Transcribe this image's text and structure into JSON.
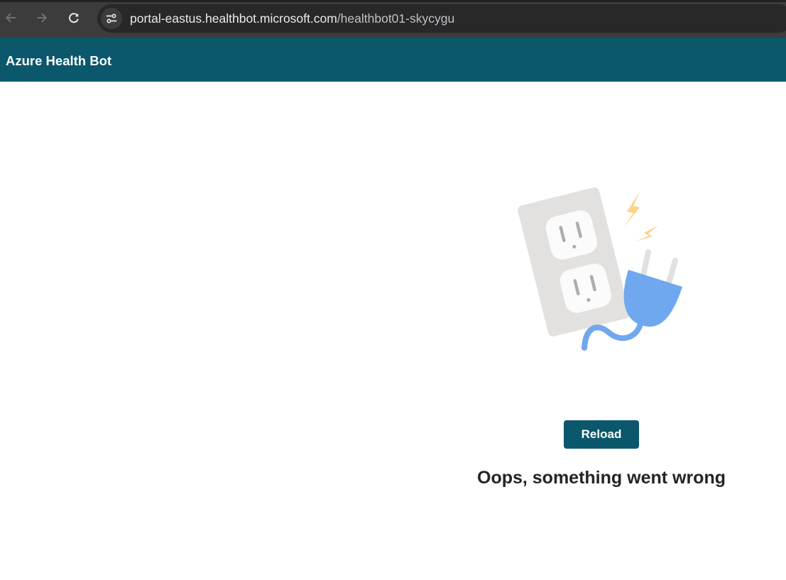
{
  "browser": {
    "url_host": "portal-eastus.healthbot.microsoft.com",
    "url_path": "/healthbot01-skycygu",
    "icons": {
      "back": "arrow-left-icon",
      "forward": "arrow-right-icon",
      "reload": "reload-icon",
      "site_info": "tune-icon"
    }
  },
  "header": {
    "title": "Azure Health Bot"
  },
  "error": {
    "illustration": "unplugged-outlet-illustration",
    "reload_label": "Reload",
    "message": "Oops, something went wrong"
  },
  "colors": {
    "brand": "#0b576b",
    "plug": "#6fa8ef",
    "spark": "#fcd289",
    "outlet_plate": "#e3e1df"
  }
}
